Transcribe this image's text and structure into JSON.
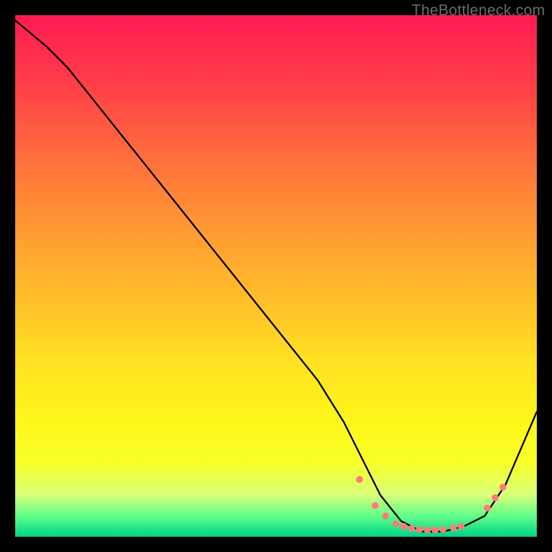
{
  "watermark": "TheBottleneck.com",
  "chart_data": {
    "type": "line",
    "title": "",
    "xlabel": "",
    "ylabel": "",
    "xlim": [
      0,
      100
    ],
    "ylim": [
      0,
      100
    ],
    "grid": false,
    "legend": false,
    "series": [
      {
        "name": "bottleneck-curve",
        "color": "#000000",
        "x": [
          0,
          6,
          10,
          18,
          26,
          34,
          42,
          50,
          58,
          63,
          67,
          70,
          74,
          78,
          82,
          86,
          90,
          94,
          100
        ],
        "values": [
          99,
          94,
          90,
          80,
          70,
          60,
          50,
          40,
          30,
          22,
          14,
          8,
          3,
          1,
          1,
          2,
          4,
          10,
          24
        ]
      }
    ],
    "markers": {
      "name": "bottleneck-dots",
      "color": "#ff7a7a",
      "radius_px": 5,
      "x": [
        66,
        69,
        71,
        73,
        74.5,
        76,
        77.5,
        79,
        80.5,
        82,
        84,
        85.5,
        90.5,
        92,
        93.5
      ],
      "values": [
        11,
        6,
        4,
        2.5,
        2,
        1.6,
        1.4,
        1.3,
        1.3,
        1.4,
        1.7,
        2,
        5.5,
        7.5,
        9.5
      ]
    }
  }
}
